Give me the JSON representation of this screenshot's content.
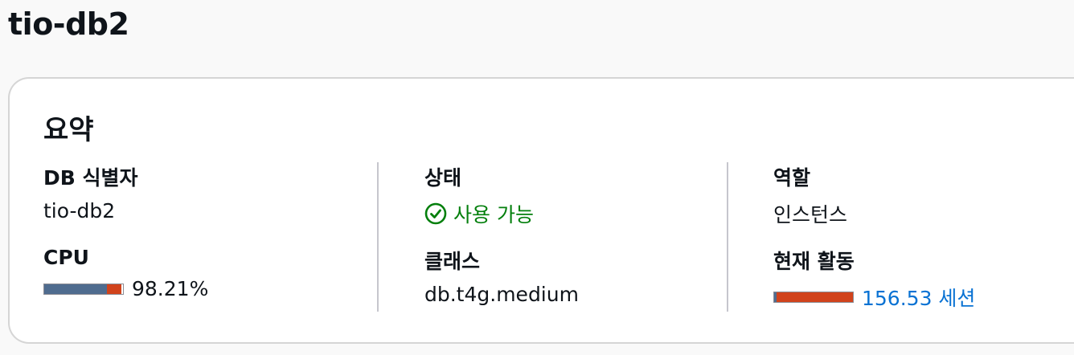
{
  "page": {
    "title": "tio-db2"
  },
  "summary": {
    "title": "요약",
    "db_identifier": {
      "label": "DB 식별자",
      "value": "tio-db2"
    },
    "cpu": {
      "label": "CPU",
      "value": "98.21%",
      "percent": 98.21,
      "bar_colors": [
        "#4f6c8f",
        "#d1431c"
      ]
    },
    "status": {
      "label": "상태",
      "value": "사용 가능",
      "icon": "check-circle-icon",
      "color": "#037f0c"
    },
    "class": {
      "label": "클래스",
      "value": "db.t4g.medium"
    },
    "role": {
      "label": "역할",
      "value": "인스턴스"
    },
    "current_activity": {
      "label": "현재 활동",
      "value": "156.53 세션",
      "bar_colors": [
        "#4f6c8f",
        "#d1431c"
      ],
      "link_color": "#0972d3"
    }
  }
}
